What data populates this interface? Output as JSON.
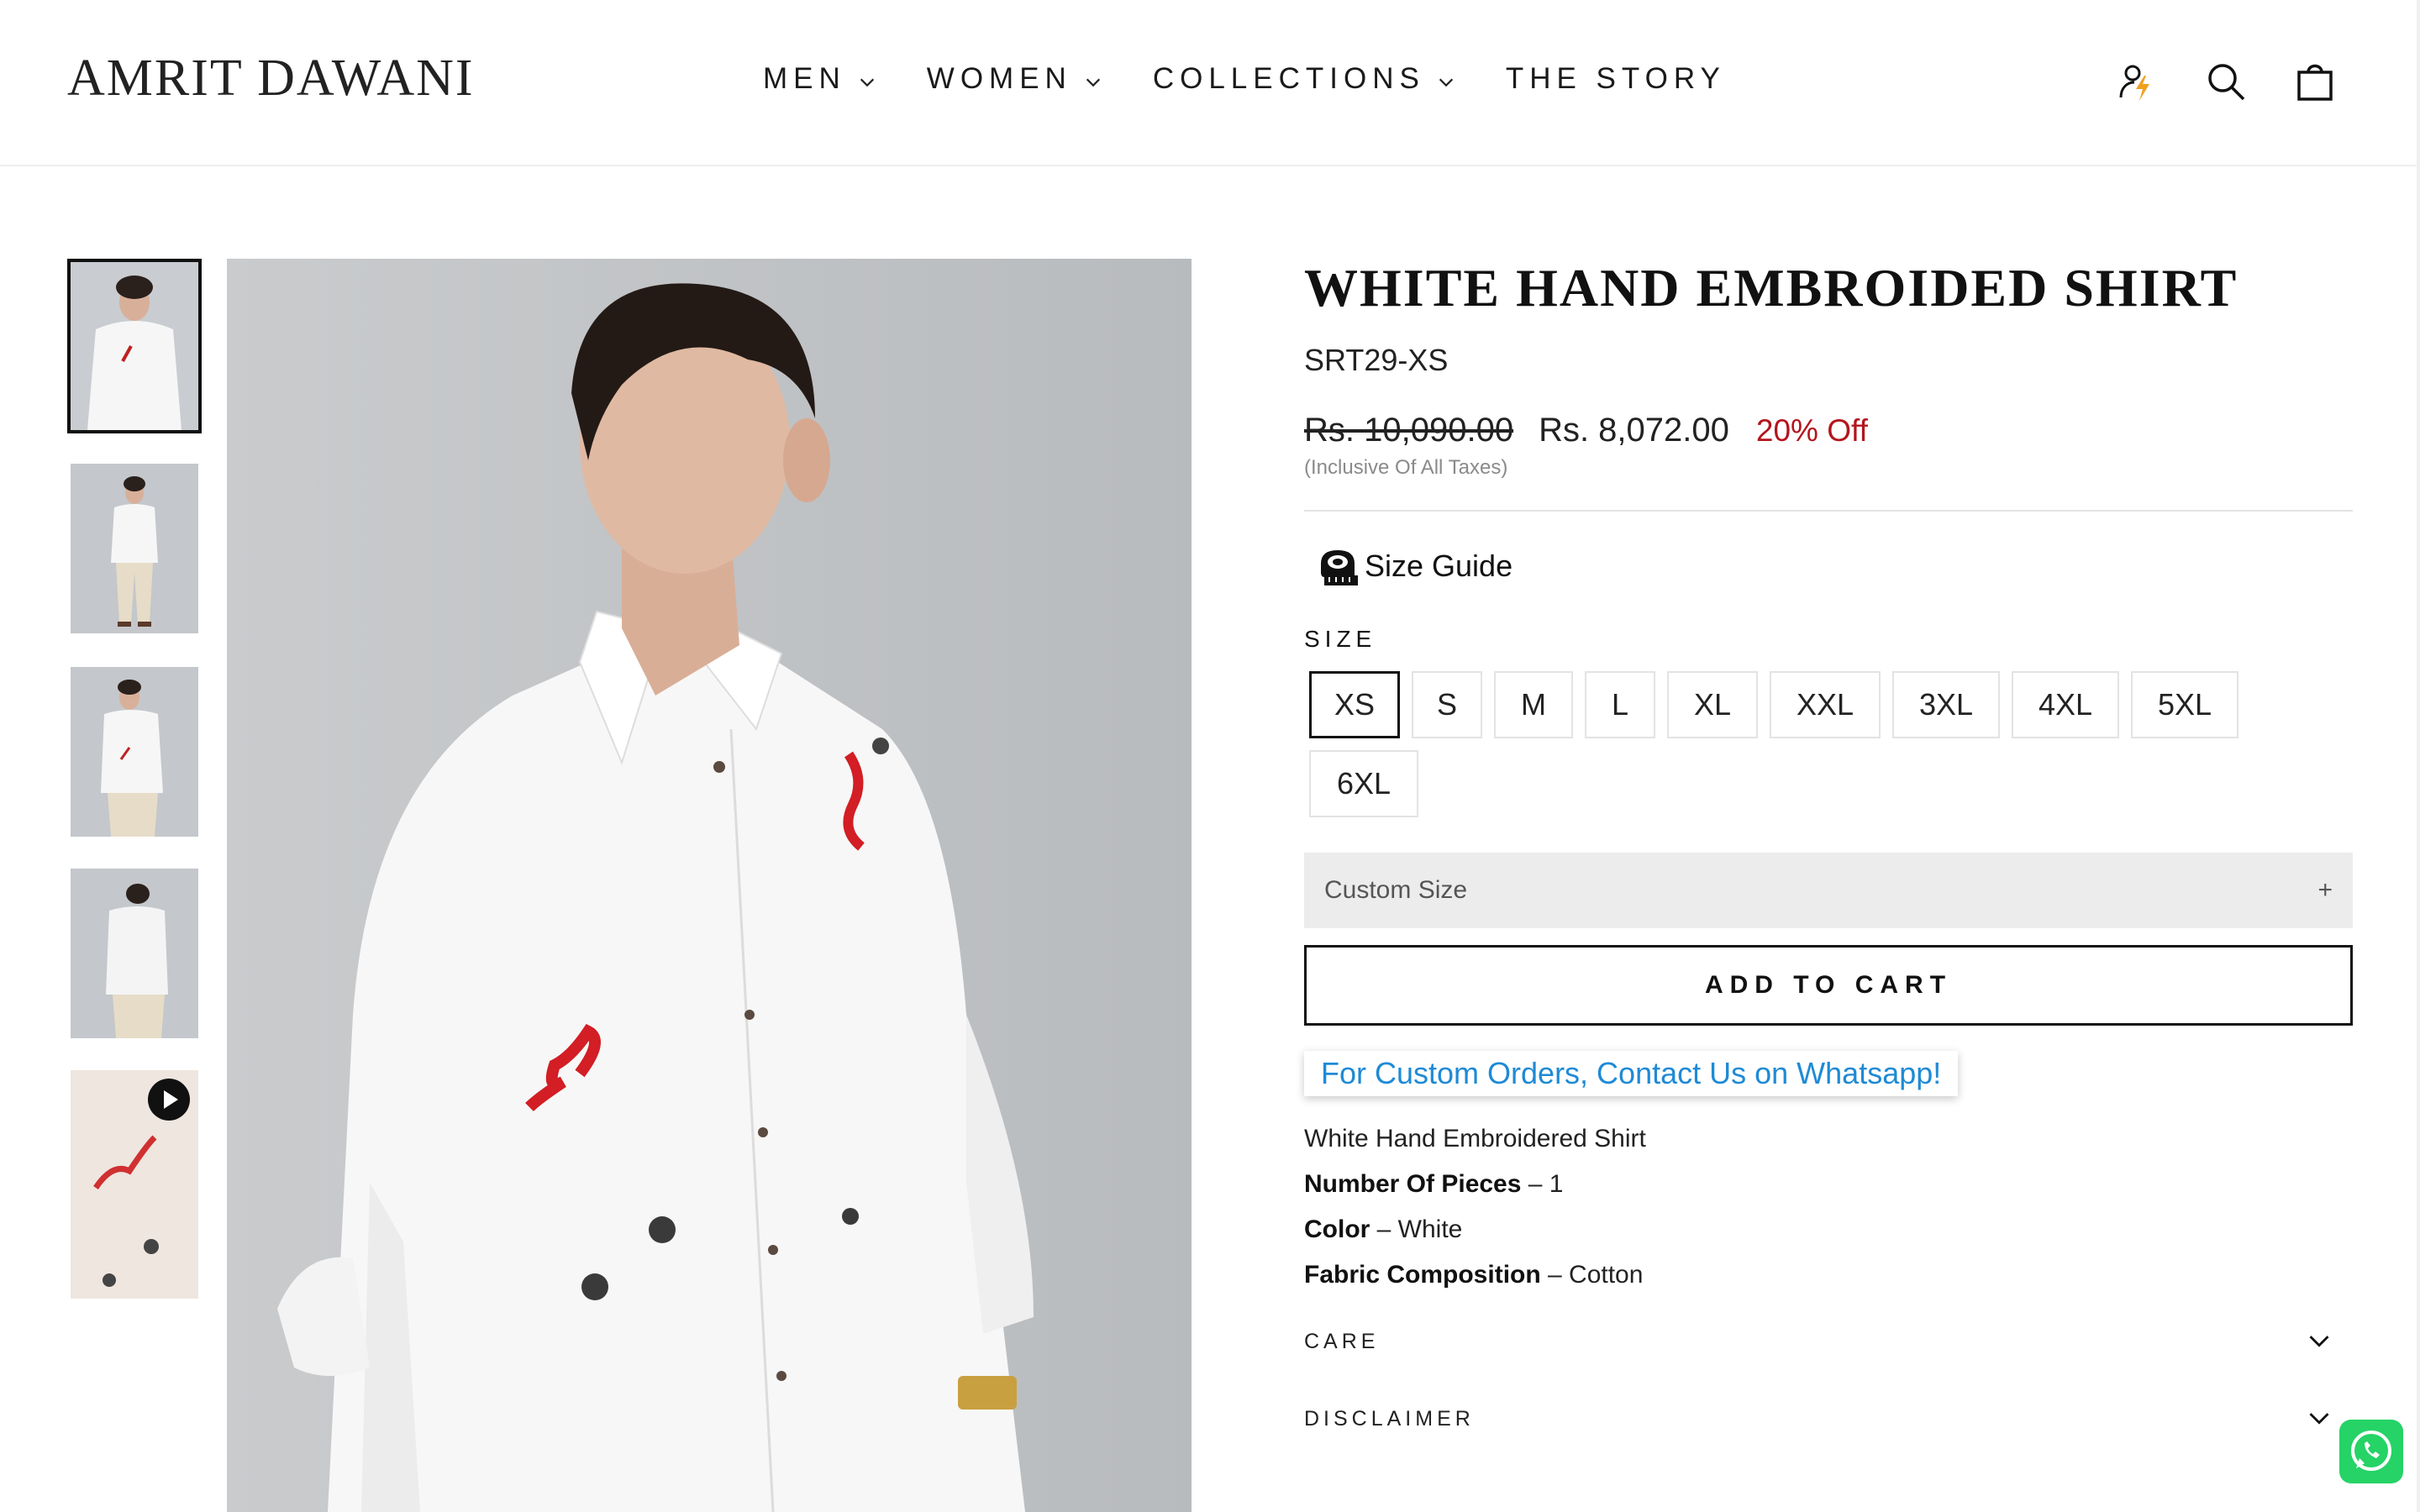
{
  "brand": {
    "logo": "AMRIT DAWANI"
  },
  "nav": {
    "items": [
      {
        "label": "MEN",
        "has_dropdown": true
      },
      {
        "label": "WOMEN",
        "has_dropdown": true
      },
      {
        "label": "COLLECTIONS",
        "has_dropdown": true
      },
      {
        "label": "THE STORY",
        "has_dropdown": false
      }
    ]
  },
  "header_icons": [
    "account-icon",
    "search-icon",
    "cart-icon"
  ],
  "gallery": {
    "thumbnails": [
      {
        "kind": "image",
        "active": true
      },
      {
        "kind": "image",
        "active": false
      },
      {
        "kind": "image",
        "active": false
      },
      {
        "kind": "image",
        "active": false
      },
      {
        "kind": "video",
        "active": false
      }
    ]
  },
  "product": {
    "title": "WHITE HAND EMBROIDED SHIRT",
    "sku": "SRT29-XS",
    "old_price": "Rs. 10,090.00",
    "new_price": "Rs. 8,072.00",
    "discount": "20% Off",
    "tax_note": "(Inclusive Of All Taxes)",
    "size_guide": "Size Guide",
    "size_label": "SIZE",
    "sizes": [
      "XS",
      "S",
      "M",
      "L",
      "XL",
      "XXL",
      "3XL",
      "4XL",
      "5XL",
      "6XL"
    ],
    "selected_size": "XS",
    "custom_size": "Custom Size",
    "custom_size_icon": "+",
    "add_to_cart": "ADD TO CART",
    "whatsapp_cta": "For Custom Orders, Contact Us on Whatsapp!",
    "description": {
      "name": "White Hand Embroidered Shirt",
      "pieces_label": "Number Of Pieces",
      "pieces_value": " – 1",
      "color_label": "Color",
      "color_value": " – White",
      "fabric_label": "Fabric Composition",
      "fabric_value": " – Cotton"
    },
    "accordions": [
      "CARE",
      "DISCLAIMER"
    ]
  },
  "colors": {
    "discount": "#b3151c",
    "link": "#1e8ad6",
    "whatsapp": "#25d366"
  }
}
